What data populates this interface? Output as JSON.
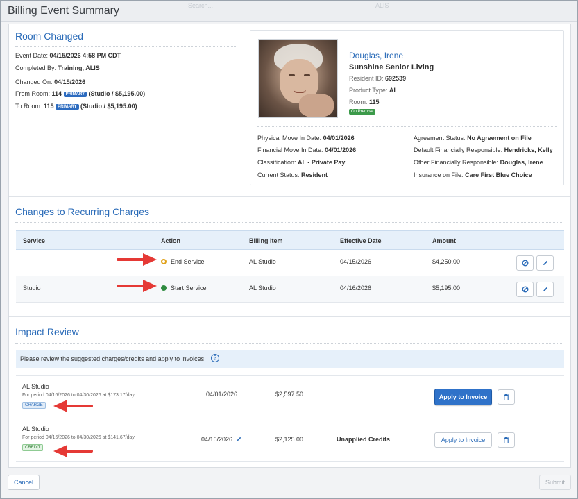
{
  "window": {
    "title": "Billing Event Summary",
    "ghost_search": "Search...",
    "ghost_right": "ALIS"
  },
  "event": {
    "title": "Room Changed",
    "event_date_label": "Event Date:",
    "event_date": "04/15/2026 4:58 PM CDT",
    "completed_by_label": "Completed By:",
    "completed_by": "Training, ALIS",
    "changed_on_label": "Changed On:",
    "changed_on": "04/15/2026",
    "from_room_label": "From Room:",
    "from_room": "114",
    "from_room_badge": "PRIMARY",
    "from_room_detail": "(Studio / $5,195.00)",
    "to_room_label": "To Room:",
    "to_room": "115",
    "to_room_badge": "PRIMARY",
    "to_room_detail": "(Studio / $5,195.00)"
  },
  "resident": {
    "name": "Douglas, Irene",
    "community": "Sunshine Senior Living",
    "id_label": "Resident ID:",
    "id": "692539",
    "product_label": "Product Type:",
    "product": "AL",
    "room_label": "Room:",
    "room": "115",
    "status_badge": "On Premise",
    "physical_move_label": "Physical Move In Date:",
    "physical_move": "04/01/2026",
    "financial_move_label": "Financial Move In Date:",
    "financial_move": "04/01/2026",
    "classification_label": "Classification:",
    "classification": "AL - Private Pay",
    "current_status_label": "Current Status:",
    "current_status": "Resident",
    "agreement_label": "Agreement Status:",
    "agreement": "No Agreement on File",
    "default_fin_label": "Default Financially Responsible:",
    "default_fin": "Hendricks, Kelly",
    "other_fin_label": "Other Financially Responsible:",
    "other_fin": "Douglas, Irene",
    "insurance_label": "Insurance on File:",
    "insurance": "Care First Blue Choice"
  },
  "recurring": {
    "title": "Changes to Recurring Charges",
    "headers": [
      "Service",
      "Action",
      "Billing Item",
      "Effective Date",
      "Amount"
    ],
    "rows": [
      {
        "service": "",
        "action": "End Service",
        "billing_item": "AL Studio",
        "effective_date": "04/15/2026",
        "amount": "$4,250.00",
        "action_color": "#e0a21b"
      },
      {
        "service": "Studio",
        "action": "Start Service",
        "billing_item": "AL Studio",
        "effective_date": "04/16/2026",
        "amount": "$5,195.00",
        "action_color": "#2e8b3f"
      }
    ]
  },
  "impact": {
    "title": "Impact Review",
    "info": "Please review the suggested charges/credits and apply to invoices",
    "rows": [
      {
        "item": "AL Studio",
        "period": "For period 04/16/2026 to 04/30/2026 at $173.17/day",
        "tag": "CHARGE",
        "date": "04/01/2026",
        "amount": "$2,597.50",
        "note": "",
        "apply_label": "Apply to Invoice"
      },
      {
        "item": "AL Studio",
        "period": "For period 04/16/2026 to 04/30/2026 at $141.67/day",
        "tag": "CREDIT",
        "date": "04/16/2026",
        "amount": "$2,125.00",
        "note": "Unapplied Credits",
        "apply_label": "Apply to Invoice"
      }
    ]
  },
  "footer": {
    "cancel_label": "Cancel",
    "submit_label": "Submit"
  },
  "colors": {
    "accent": "#2a6bb8",
    "primary_button": "#2f72c9",
    "annotation_arrow": "#e53935"
  }
}
